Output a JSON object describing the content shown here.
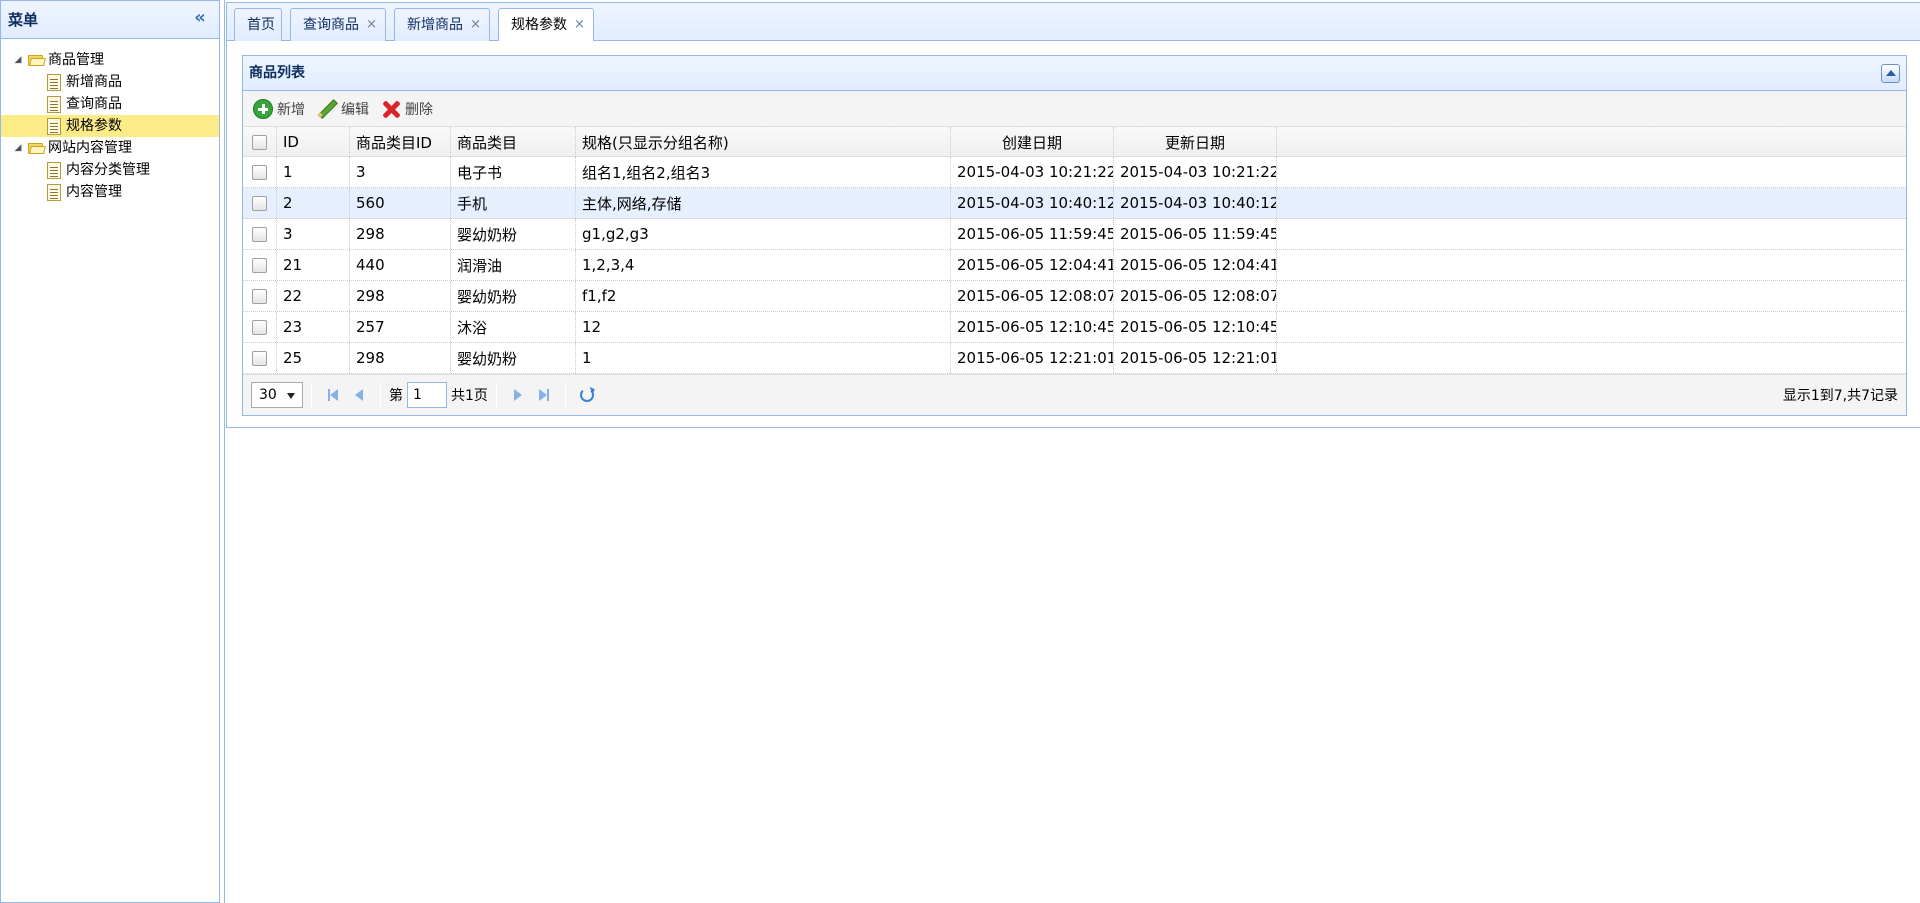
{
  "menu": {
    "title": "菜单",
    "collapse_symbol": "«",
    "tree": [
      {
        "label": "商品管理",
        "expanded": true
      },
      {
        "label": "新增商品"
      },
      {
        "label": "查询商品"
      },
      {
        "label": "规格参数",
        "selected": true
      },
      {
        "label": "网站内容管理",
        "expanded": true
      },
      {
        "label": "内容分类管理"
      },
      {
        "label": "内容管理"
      }
    ]
  },
  "tabs": [
    {
      "label": "首页",
      "closable": false
    },
    {
      "label": "查询商品",
      "closable": true
    },
    {
      "label": "新增商品",
      "closable": true
    },
    {
      "label": "规格参数",
      "closable": true,
      "active": true
    }
  ],
  "tab_close_symbol": "×",
  "grid": {
    "title": "商品列表",
    "toolbar": {
      "add_label": "新增",
      "edit_label": "编辑",
      "delete_label": "删除"
    },
    "columns": [
      "ID",
      "商品类目ID",
      "商品类目",
      "规格(只显示分组名称)",
      "创建日期",
      "更新日期"
    ],
    "rows": [
      [
        "1",
        "3",
        "电子书",
        "组名1,组名2,组名3",
        "2015-04-03 10:21:22",
        "2015-04-03 10:21:22"
      ],
      [
        "2",
        "560",
        "手机",
        "主体,网络,存储",
        "2015-04-03 10:40:12",
        "2015-04-03 10:40:12"
      ],
      [
        "3",
        "298",
        "婴幼奶粉",
        "g1,g2,g3",
        "2015-06-05 11:59:45",
        "2015-06-05 11:59:45"
      ],
      [
        "21",
        "440",
        "润滑油",
        "1,2,3,4",
        "2015-06-05 12:04:41",
        "2015-06-05 12:04:41"
      ],
      [
        "22",
        "298",
        "婴幼奶粉",
        "f1,f2",
        "2015-06-05 12:08:07",
        "2015-06-05 12:08:07"
      ],
      [
        "23",
        "257",
        "沐浴",
        "12",
        "2015-06-05 12:10:45",
        "2015-06-05 12:10:45"
      ],
      [
        "25",
        "298",
        "婴幼奶粉",
        "1",
        "2015-06-05 12:21:01",
        "2015-06-05 12:21:01"
      ]
    ],
    "hover_row": 1,
    "pager": {
      "page_size": "30",
      "page_prefix": "第",
      "page_number": "1",
      "page_total": "共1页",
      "info": "显示1到7,共7记录"
    }
  }
}
